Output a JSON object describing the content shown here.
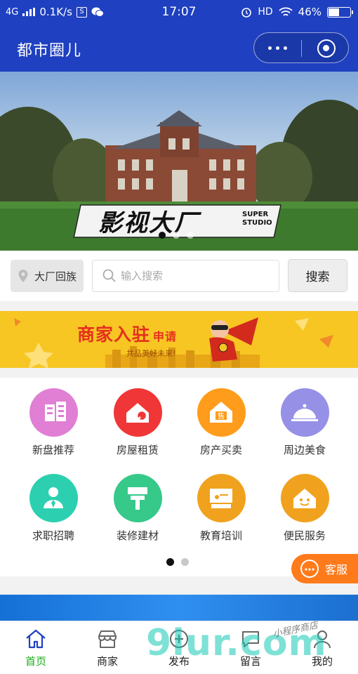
{
  "status_bar": {
    "network": "4G",
    "speed": "0.1K/s",
    "time": "17:07",
    "hd": "HD",
    "battery": "46%"
  },
  "header": {
    "title": "都市圈儿"
  },
  "banner": {
    "caption": "影视大厂",
    "caption_sub": "SUPER STUDIO",
    "slides": 3,
    "active_slide": 0
  },
  "search": {
    "location": "大厂回族",
    "placeholder": "输入搜索",
    "button": "搜索"
  },
  "ad": {
    "text": "商家入驻",
    "badge": "申请",
    "sub": "共品美好未来!"
  },
  "categories": [
    {
      "label": "新盘推荐",
      "icon": "building-icon",
      "color": "#e07fd3"
    },
    {
      "label": "房屋租赁",
      "icon": "house-key-icon",
      "color": "#f03636"
    },
    {
      "label": "房产买卖",
      "icon": "sale-house-icon",
      "color": "#ff9c1b"
    },
    {
      "label": "周边美食",
      "icon": "food-cloche-icon",
      "color": "#9690e6"
    },
    {
      "label": "求职招聘",
      "icon": "person-tie-icon",
      "color": "#2cd0b0"
    },
    {
      "label": "装修建材",
      "icon": "paint-roller-icon",
      "color": "#36c98a"
    },
    {
      "label": "教育培训",
      "icon": "classroom-icon",
      "color": "#f0a21e"
    },
    {
      "label": "便民服务",
      "icon": "smile-house-icon",
      "color": "#f0a21e"
    }
  ],
  "grid_pages": 2,
  "grid_active_page": 0,
  "service_button": "客服",
  "tabs": [
    {
      "label": "首页",
      "icon": "home-icon",
      "active": true
    },
    {
      "label": "商家",
      "icon": "store-icon",
      "active": false
    },
    {
      "label": "发布",
      "icon": "plus-icon",
      "active": false
    },
    {
      "label": "留言",
      "icon": "message-icon",
      "active": false
    },
    {
      "label": "我的",
      "icon": "user-icon",
      "active": false
    }
  ],
  "watermark": {
    "text": "9lur.com",
    "script": "小程序商店"
  },
  "colors": {
    "header": "#1f40c0",
    "accent_green": "#1aad19",
    "service": "#ff7a1a",
    "ad_bg": "#f7c623",
    "ad_text": "#e5301e"
  }
}
